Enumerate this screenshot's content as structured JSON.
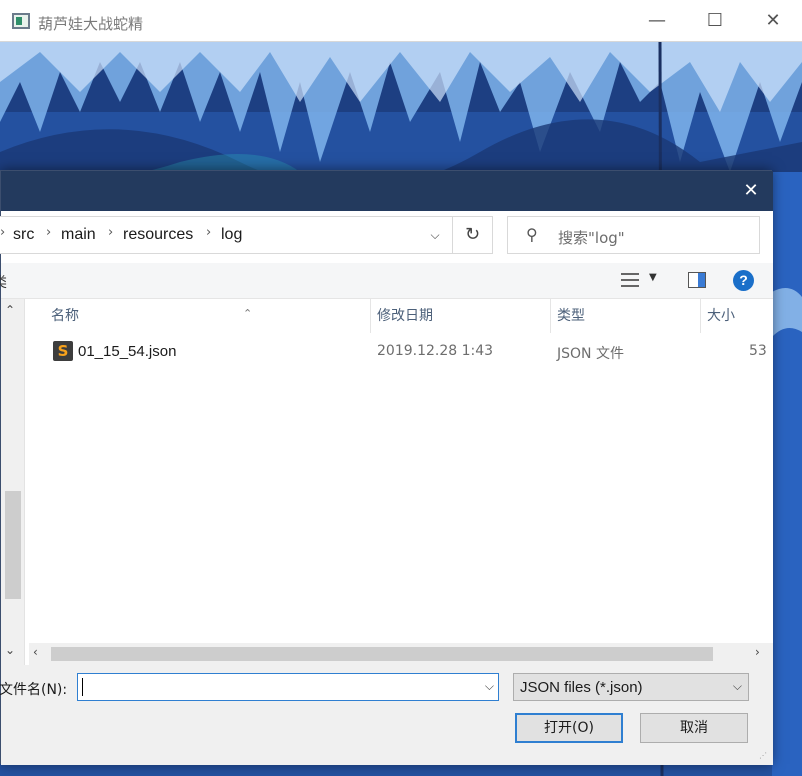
{
  "game_window": {
    "title": "葫芦娃大战蛇精",
    "min_glyph": "—",
    "max_glyph": "☐",
    "close_glyph": "✕"
  },
  "dialog": {
    "close_glyph": "✕",
    "breadcrumb": {
      "chevron_partial": "›",
      "items": [
        "src",
        "main",
        "resources",
        "log"
      ],
      "sep": "›"
    },
    "address_dropdown_glyph": "⌵",
    "refresh_glyph": "↻",
    "search": {
      "icon": "search-icon",
      "glyph": "⚲",
      "placeholder": "搜索\"log\""
    },
    "toolbar": {
      "partial_label": "类",
      "view_dropdown_glyph": "▼",
      "help_glyph": "?"
    },
    "nav": {
      "up_glyph": "⌃",
      "down_glyph": "⌄",
      "partial_text": ")"
    },
    "columns": {
      "name": "名称",
      "modified": "修改日期",
      "type": "类型",
      "size": "大小",
      "sort_glyph": "⌃"
    },
    "files": [
      {
        "name": "01_15_54.json",
        "modified": "2019.12.28 1:43",
        "type": "JSON 文件",
        "size": "53",
        "icon": "sublime-file-icon",
        "icon_glyph": "S"
      }
    ],
    "hscroll": {
      "left_glyph": "‹",
      "right_glyph": "›"
    },
    "filename": {
      "label": "文件名(N):",
      "value": "",
      "dropdown_glyph": "⌵"
    },
    "filetype": {
      "selected": "JSON files (*.json)",
      "dropdown_glyph": "⌵"
    },
    "buttons": {
      "open": "打开(O)",
      "cancel": "取消"
    },
    "grip_glyph": "⋰"
  },
  "colors": {
    "dialog_titlebar": "#233a5e",
    "accent": "#2f7fd1",
    "help_blue": "#1a6fc9"
  }
}
